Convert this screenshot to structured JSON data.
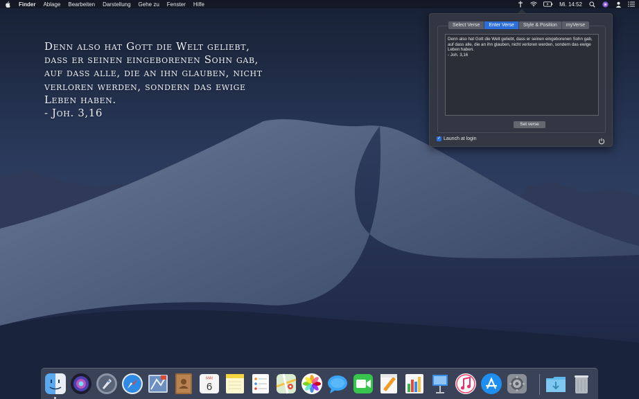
{
  "menubar": {
    "apple_icon": "apple-icon",
    "app_name": "Finder",
    "menus": [
      "Ablage",
      "Bearbeiten",
      "Darstellung",
      "Gehe zu",
      "Fenster",
      "Hilfe"
    ],
    "clock": "Mi. 14:52",
    "status_icons": [
      "cross-icon",
      "wifi-icon",
      "battery-icon",
      "search-icon",
      "siri-icon",
      "user-icon",
      "list-icon"
    ]
  },
  "desktop_verse": "Denn also hat Gott die Welt geliebt,\ndass er seinen eingeborenen Sohn gab,\nauf dass alle, die an ihn glauben, nicht\nverloren werden, sondern das ewige\nLeben haben.\n- Joh. 3,16",
  "popover": {
    "tabs": [
      "Select Verse",
      "Enter Verse",
      "Style & Position",
      "myVerse"
    ],
    "active_tab": "Enter Verse",
    "textarea_value": "Denn also hat Gott die Welt geliebt, dass er seinen eingeborenen Sohn gab, auf dass alle, die an ihn glauben, nicht verloren werden, sondern das ewige Leben haben.\n- Joh. 3,16",
    "set_verse_label": "Set verse",
    "launch_at_login_label": "Launch at login",
    "launch_at_login_checked": true
  },
  "dock": {
    "items": [
      "finder-icon",
      "siri-icon",
      "launchpad-icon",
      "safari-icon",
      "mail-icon",
      "contacts-icon",
      "calendar-icon",
      "notes-icon",
      "reminders-icon",
      "maps-icon",
      "photos-icon",
      "messages-icon",
      "facetime-icon",
      "pages-icon",
      "numbers-icon",
      "keynote-icon",
      "itunes-icon",
      "app-store-icon",
      "system-preferences-icon",
      "downloads-folder-icon",
      "trash-icon"
    ],
    "calendar_month": "MAI",
    "calendar_day": "6"
  },
  "colors": {
    "accent": "#2c6fdb",
    "popover_bg": "#343842"
  }
}
